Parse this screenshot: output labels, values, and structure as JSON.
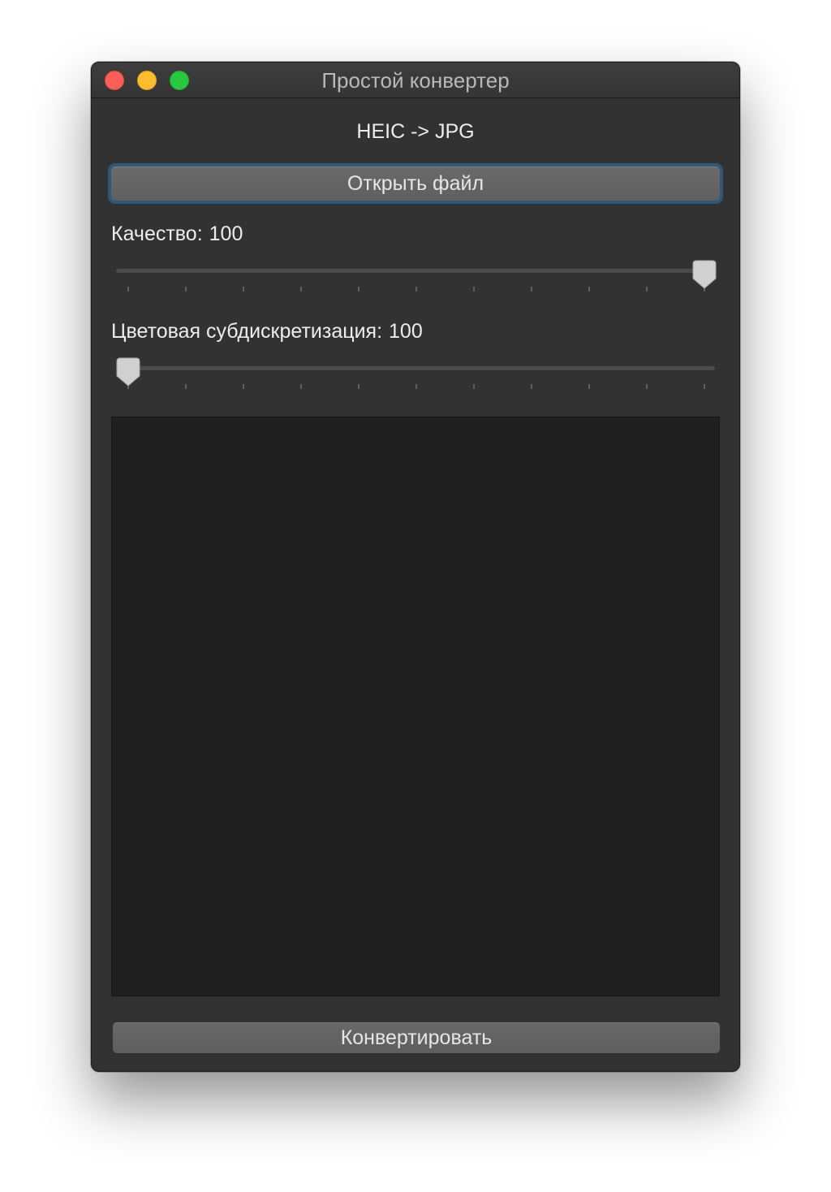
{
  "window": {
    "title": "Простой конвертер",
    "subtitle": "HEIC -> JPG"
  },
  "buttons": {
    "open_file": "Открыть файл",
    "convert": "Конвертировать"
  },
  "quality": {
    "label": "Качество:",
    "value": "100",
    "slider_level": 1.0,
    "tick_count": 11
  },
  "chroma_subsampling": {
    "label": "Цветовая субдискретизация:",
    "value": "100",
    "slider_level": 0.0,
    "tick_count": 11
  },
  "colors": {
    "window_bg": "#323232",
    "preview_bg": "#1f1f1f",
    "focus_ring": "#2f5778",
    "close": "#fc5f57",
    "minimize": "#fdbc2e",
    "maximize": "#2ac840"
  }
}
